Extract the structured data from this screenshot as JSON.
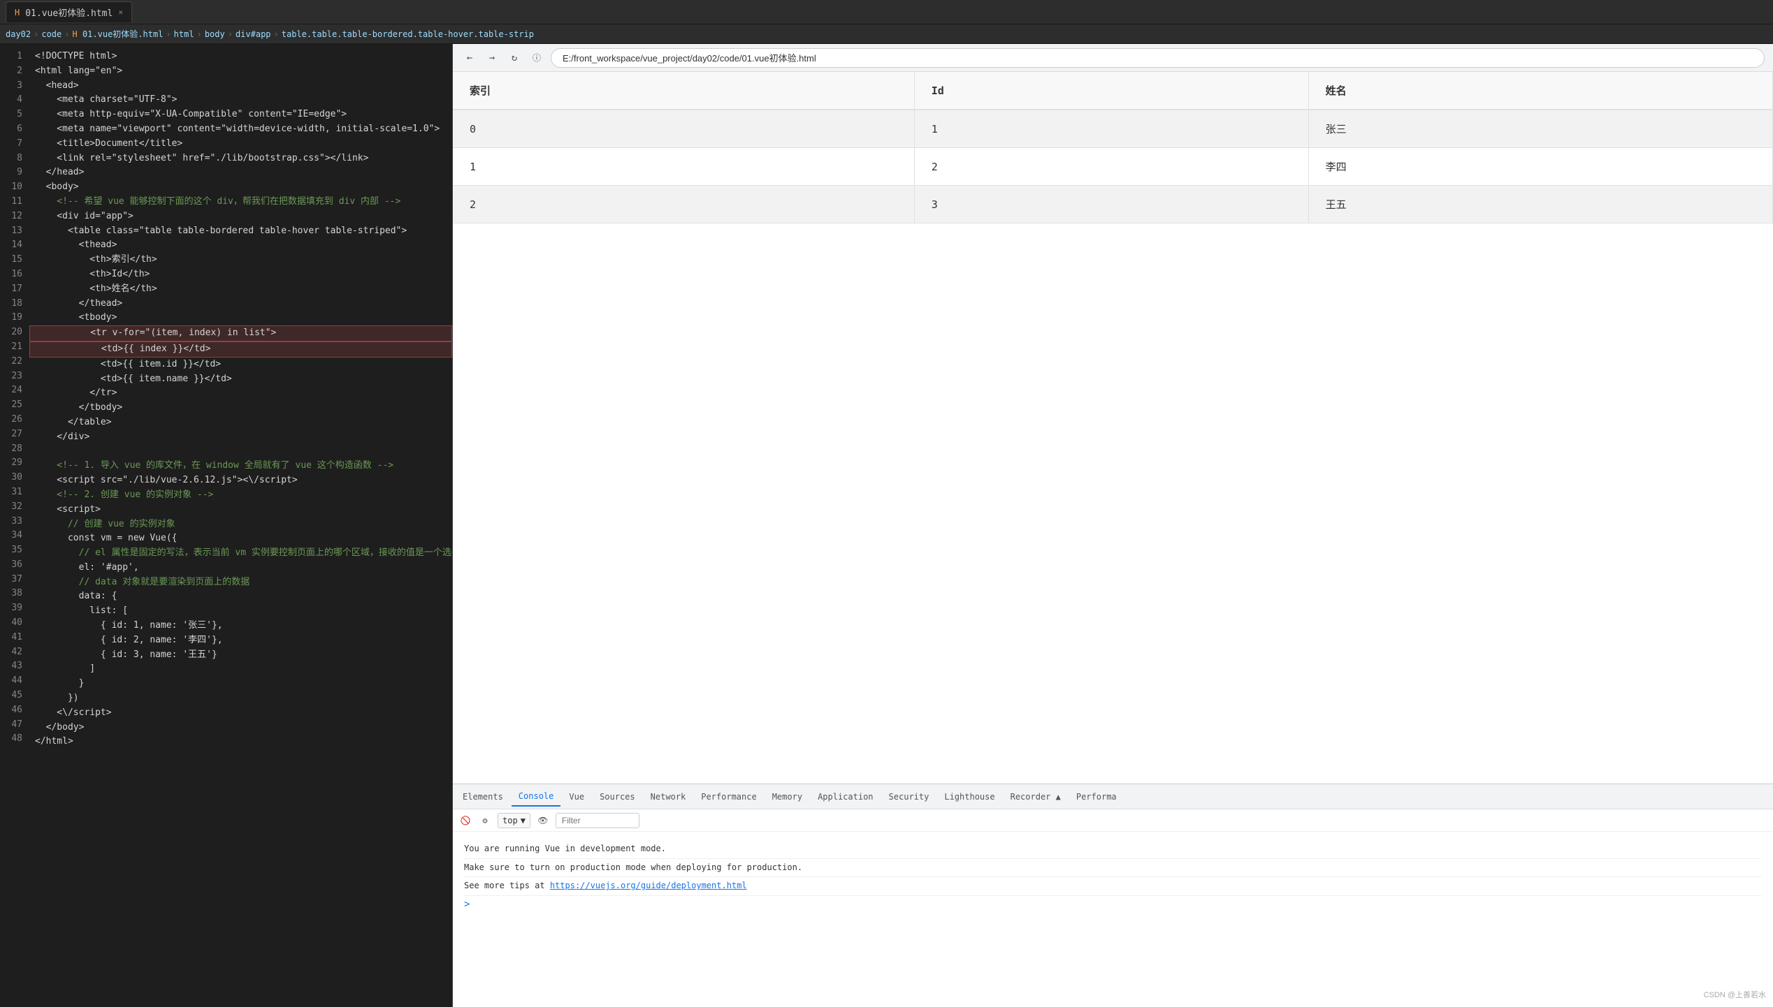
{
  "tab": {
    "title": "01.vue初体验.html",
    "close_label": "×",
    "icon": "H"
  },
  "breadcrumb": {
    "items": [
      "day02",
      "code",
      "H 01.vue初体验.html",
      "html",
      "body",
      "div#app",
      "table.table.table-bordered.table-hover.table-strip"
    ]
  },
  "address_bar": {
    "url": "E:/front_workspace/vue_project/day02/code/01.vue初体验.html",
    "back_btn": "←",
    "forward_btn": "→",
    "refresh_btn": "↻",
    "info_btn": "ⓘ"
  },
  "code": {
    "lines": [
      {
        "num": 1,
        "text": "<!DOCTYPE html>",
        "highlight": false
      },
      {
        "num": 2,
        "text": "<html lang=\"en\">",
        "highlight": false
      },
      {
        "num": 3,
        "text": "  <head>",
        "highlight": false
      },
      {
        "num": 4,
        "text": "    <meta charset=\"UTF-8\">",
        "highlight": false
      },
      {
        "num": 5,
        "text": "    <meta http-equiv=\"X-UA-Compatible\" content=\"IE=edge\">",
        "highlight": false
      },
      {
        "num": 6,
        "text": "    <meta name=\"viewport\" content=\"width=device-width, initial-scale=1.0\">",
        "highlight": false
      },
      {
        "num": 7,
        "text": "    <title>Document</title>",
        "highlight": false
      },
      {
        "num": 8,
        "text": "    <link rel=\"stylesheet\" href=\"./lib/bootstrap.css\"></link>",
        "highlight": false
      },
      {
        "num": 9,
        "text": "  </head>",
        "highlight": false
      },
      {
        "num": 10,
        "text": "  <body>",
        "highlight": false
      },
      {
        "num": 11,
        "text": "    <!-- 希望 vue 能够控制下面的这个 div，帮我们在把数据填充到 div 内部 -->",
        "highlight": false
      },
      {
        "num": 12,
        "text": "    <div id=\"app\">",
        "highlight": false
      },
      {
        "num": 13,
        "text": "      <table class=\"table table-bordered table-hover table-striped\">",
        "highlight": false
      },
      {
        "num": 14,
        "text": "        <thead>",
        "highlight": false
      },
      {
        "num": 15,
        "text": "          <th>索引</th>",
        "highlight": false
      },
      {
        "num": 16,
        "text": "          <th>Id</th>",
        "highlight": false
      },
      {
        "num": 17,
        "text": "          <th>姓名</th>",
        "highlight": false
      },
      {
        "num": 18,
        "text": "        </thead>",
        "highlight": false
      },
      {
        "num": 19,
        "text": "        <tbody>",
        "highlight": false
      },
      {
        "num": 20,
        "text": "          <tr v-for=\"(item, index) in list\">",
        "highlight": true
      },
      {
        "num": 21,
        "text": "            <td>{{ index }}</td>",
        "highlight": true
      },
      {
        "num": 22,
        "text": "            <td>{{ item.id }}</td>",
        "highlight": false
      },
      {
        "num": 23,
        "text": "            <td>{{ item.name }}</td>",
        "highlight": false
      },
      {
        "num": 24,
        "text": "          </tr>",
        "highlight": false
      },
      {
        "num": 25,
        "text": "        </tbody>",
        "highlight": false
      },
      {
        "num": 26,
        "text": "      </table>",
        "highlight": false
      },
      {
        "num": 27,
        "text": "    </div>",
        "highlight": false
      },
      {
        "num": 28,
        "text": "",
        "highlight": false
      },
      {
        "num": 29,
        "text": "    <!-- 1. 导入 vue 的库文件，在 window 全局就有了 vue 这个构造函数 -->",
        "highlight": false
      },
      {
        "num": 30,
        "text": "    <script src=\"./lib/vue-2.6.12.js\"><\\/script>",
        "highlight": false
      },
      {
        "num": 31,
        "text": "    <!-- 2. 创建 vue 的实例对象 -->",
        "highlight": false
      },
      {
        "num": 32,
        "text": "    <script>",
        "highlight": false
      },
      {
        "num": 33,
        "text": "      // 创建 vue 的实例对象",
        "highlight": false
      },
      {
        "num": 34,
        "text": "      const vm = new Vue({",
        "highlight": false
      },
      {
        "num": 35,
        "text": "        // el 属性是固定的写法，表示当前 vm 实例要控制页面上的哪个区域，接收的值是一个选择器",
        "highlight": false
      },
      {
        "num": 36,
        "text": "        el: '#app',",
        "highlight": false
      },
      {
        "num": 37,
        "text": "        // data 对象就是要渲染到页面上的数据",
        "highlight": false
      },
      {
        "num": 38,
        "text": "        data: {",
        "highlight": false
      },
      {
        "num": 39,
        "text": "          list: [",
        "highlight": false
      },
      {
        "num": 40,
        "text": "            { id: 1, name: '张三'},",
        "highlight": false
      },
      {
        "num": 41,
        "text": "            { id: 2, name: '李四'},",
        "highlight": false
      },
      {
        "num": 42,
        "text": "            { id: 3, name: '王五'}",
        "highlight": false
      },
      {
        "num": 43,
        "text": "          ]",
        "highlight": false
      },
      {
        "num": 44,
        "text": "        }",
        "highlight": false
      },
      {
        "num": 45,
        "text": "      })",
        "highlight": false
      },
      {
        "num": 46,
        "text": "    <\\/script>",
        "highlight": false
      },
      {
        "num": 47,
        "text": "  </body>",
        "highlight": false
      },
      {
        "num": 48,
        "text": "</html>",
        "highlight": false
      }
    ]
  },
  "table": {
    "headers": [
      "索引",
      "Id",
      "姓名"
    ],
    "rows": [
      {
        "index": "0",
        "id": "1",
        "name": "张三"
      },
      {
        "index": "1",
        "id": "2",
        "name": "李四"
      },
      {
        "index": "2",
        "id": "3",
        "name": "王五"
      }
    ]
  },
  "devtools": {
    "tabs": [
      "Elements",
      "Console",
      "Vue",
      "Sources",
      "Network",
      "Performance",
      "Memory",
      "Application",
      "Security",
      "Lighthouse",
      "Recorder ▲",
      "Performa"
    ],
    "active_tab": "Console",
    "top_label": "top",
    "filter_placeholder": "Filter",
    "messages": [
      "You are running Vue in development mode.",
      "Make sure to turn on production mode when deploying for production.",
      "See more tips at https://vuejs.org/guide/deployment.html"
    ],
    "link": "https://vuejs.org/guide/deployment.html",
    "prompt": ">"
  },
  "watermark": "CSDN @上善若水"
}
